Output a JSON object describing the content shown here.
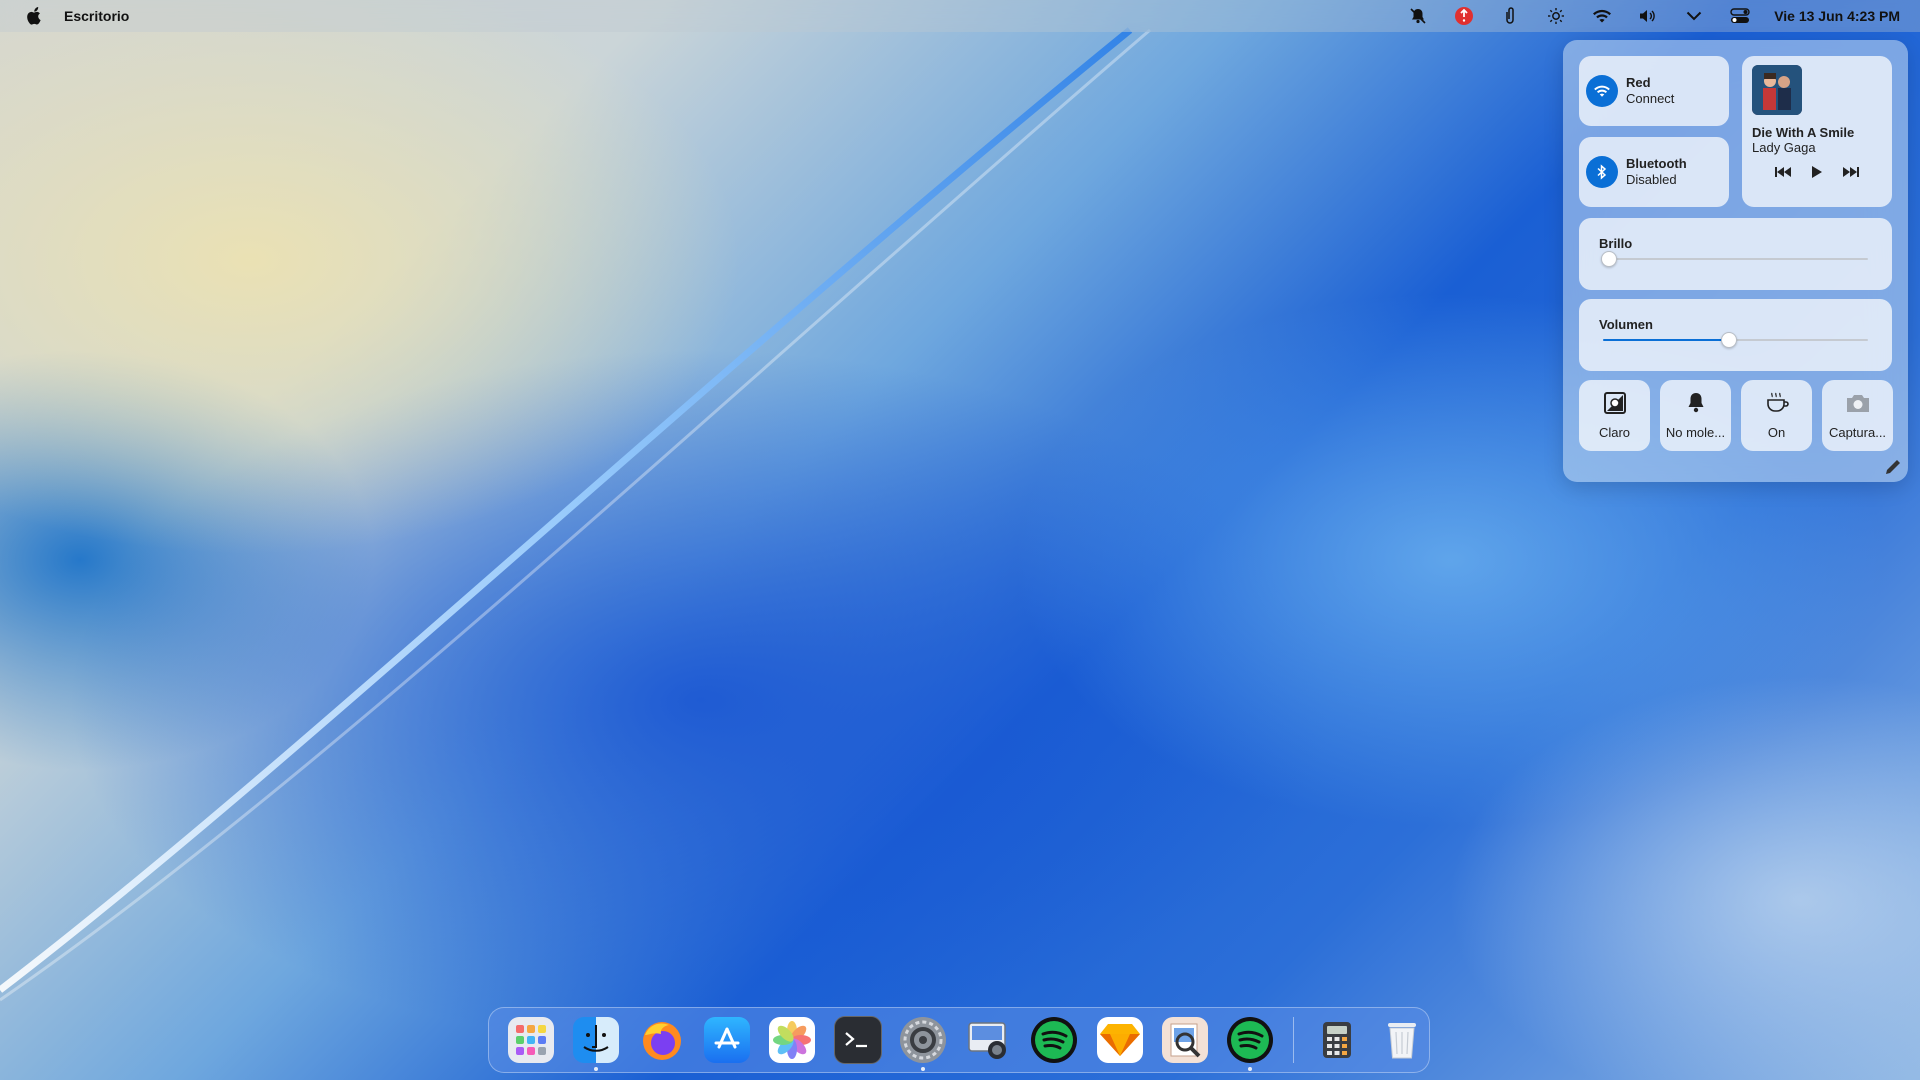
{
  "menubar": {
    "apple_icon": "apple-logo-icon",
    "app_name": "Escritorio",
    "clock": "Vie 13 Jun  4:23 PM",
    "status_icons": [
      "bell-slash-icon",
      "update-alert-icon",
      "paperclip-icon",
      "brightness-icon",
      "wifi-icon",
      "volume-icon",
      "chevron-down-icon",
      "control-center-icon"
    ]
  },
  "control_center": {
    "network": {
      "name": "Red",
      "status": "Connect"
    },
    "bluetooth": {
      "name": "Bluetooth",
      "status": "Disabled"
    },
    "now_playing": {
      "song": "Die With A Smile",
      "artist": "Lady Gaga"
    },
    "brightness": {
      "label": "Brillo",
      "value": 0.02
    },
    "volume": {
      "label": "Volumen",
      "value": 0.47
    },
    "toggles": [
      {
        "label": "Claro",
        "icon": "appearance-icon"
      },
      {
        "label": "No mole...",
        "icon": "bell-icon"
      },
      {
        "label": "On",
        "icon": "coffee-cup-icon"
      },
      {
        "label": "Captura...",
        "icon": "camera-icon"
      }
    ],
    "accent": "#0a6fd6"
  },
  "dock": {
    "items": [
      {
        "name": "launchpad",
        "running": false
      },
      {
        "name": "finder",
        "running": true
      },
      {
        "name": "firefox",
        "running": false
      },
      {
        "name": "app-store",
        "running": false
      },
      {
        "name": "photos",
        "running": false
      },
      {
        "name": "terminal",
        "running": false
      },
      {
        "name": "system-settings",
        "running": true
      },
      {
        "name": "screenshot",
        "running": false
      },
      {
        "name": "spotify",
        "running": false
      },
      {
        "name": "sketch",
        "running": false
      },
      {
        "name": "preview",
        "running": false
      },
      {
        "name": "spotify-2",
        "running": true
      },
      {
        "name": "calculator",
        "running": false
      },
      {
        "name": "trash",
        "running": false
      }
    ]
  }
}
